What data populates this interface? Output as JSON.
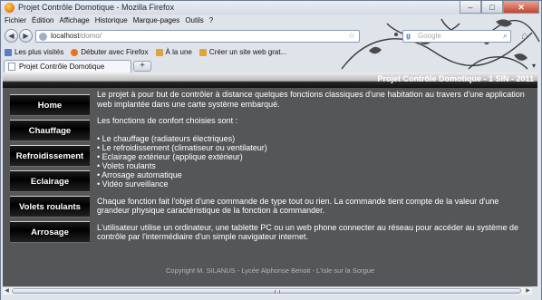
{
  "window": {
    "title": "Projet Contrôle Domotique - Mozilla Firefox",
    "minimize": "–",
    "maximize": "□",
    "close": "✕"
  },
  "menu": [
    "Fichier",
    "Édition",
    "Affichage",
    "Historique",
    "Marque-pages",
    "Outils",
    "?"
  ],
  "nav": {
    "back_icon": "arrow-left-icon",
    "forward_icon": "arrow-right-icon",
    "url_host": "localhost",
    "url_path": "/domo/",
    "search_engine": "g",
    "search_placeholder": "Google"
  },
  "bookmarks": [
    {
      "label": "Les plus visités",
      "icon": "most-visited-icon",
      "color": "#5a7fc2"
    },
    {
      "label": "Débuter avec Firefox",
      "icon": "firefox-icon",
      "color": "#e8731c"
    },
    {
      "label": "À la une",
      "icon": "rss-icon",
      "color": "#e2a43a"
    },
    {
      "label": "Créer un site web grat...",
      "icon": "page-icon",
      "color": "#e2a43a"
    }
  ],
  "tab": {
    "title": "Projet Contrôle Domotique",
    "new_tab": "+",
    "list": "▾"
  },
  "page": {
    "banner": "Projet Contrôle Domotique - 1 SIN - 2011",
    "menu": [
      "Home",
      "Chauffage",
      "Refroidissement",
      "Eclairage",
      "Volets roulants",
      "Arrosage"
    ],
    "intro": "Le projet à pour but de contrôler à distance quelques fonctions classiques d'une habitation au travers d'une application web implantée dans une carte système embarqué.",
    "features_title": "Les fonctions de confort choisies sont :",
    "features": [
      "Le chauffage (radiateurs électriques)",
      "Le refroidissement (climatiseur ou ventilateur)",
      "Eclairage extérieur (applique extérieur)",
      "Volets roulants",
      "Arrosage automatique",
      "Vidéo surveillance"
    ],
    "command": "Chaque fonction fait l'objet d'une commande de type tout ou rien. La commande tient compte de la valeur d'une grandeur physique caractéristique de la fonction à commander.",
    "user": "L'utilisateur utilise un ordinateur, une tablette PC ou un web phone connecter au réseau pour accéder au système de contrôle par l'intermédiaire d'un simple navigateur internet.",
    "footer": "Copyright M. SILANUS - Lycée Alphonse Benoit - L'Isle sur la Sorgue"
  },
  "colors": {
    "page_bg": "#555658",
    "nav_button": "#000000",
    "banner_text": "#ffffff",
    "footer_text": "#b6b6b6"
  }
}
